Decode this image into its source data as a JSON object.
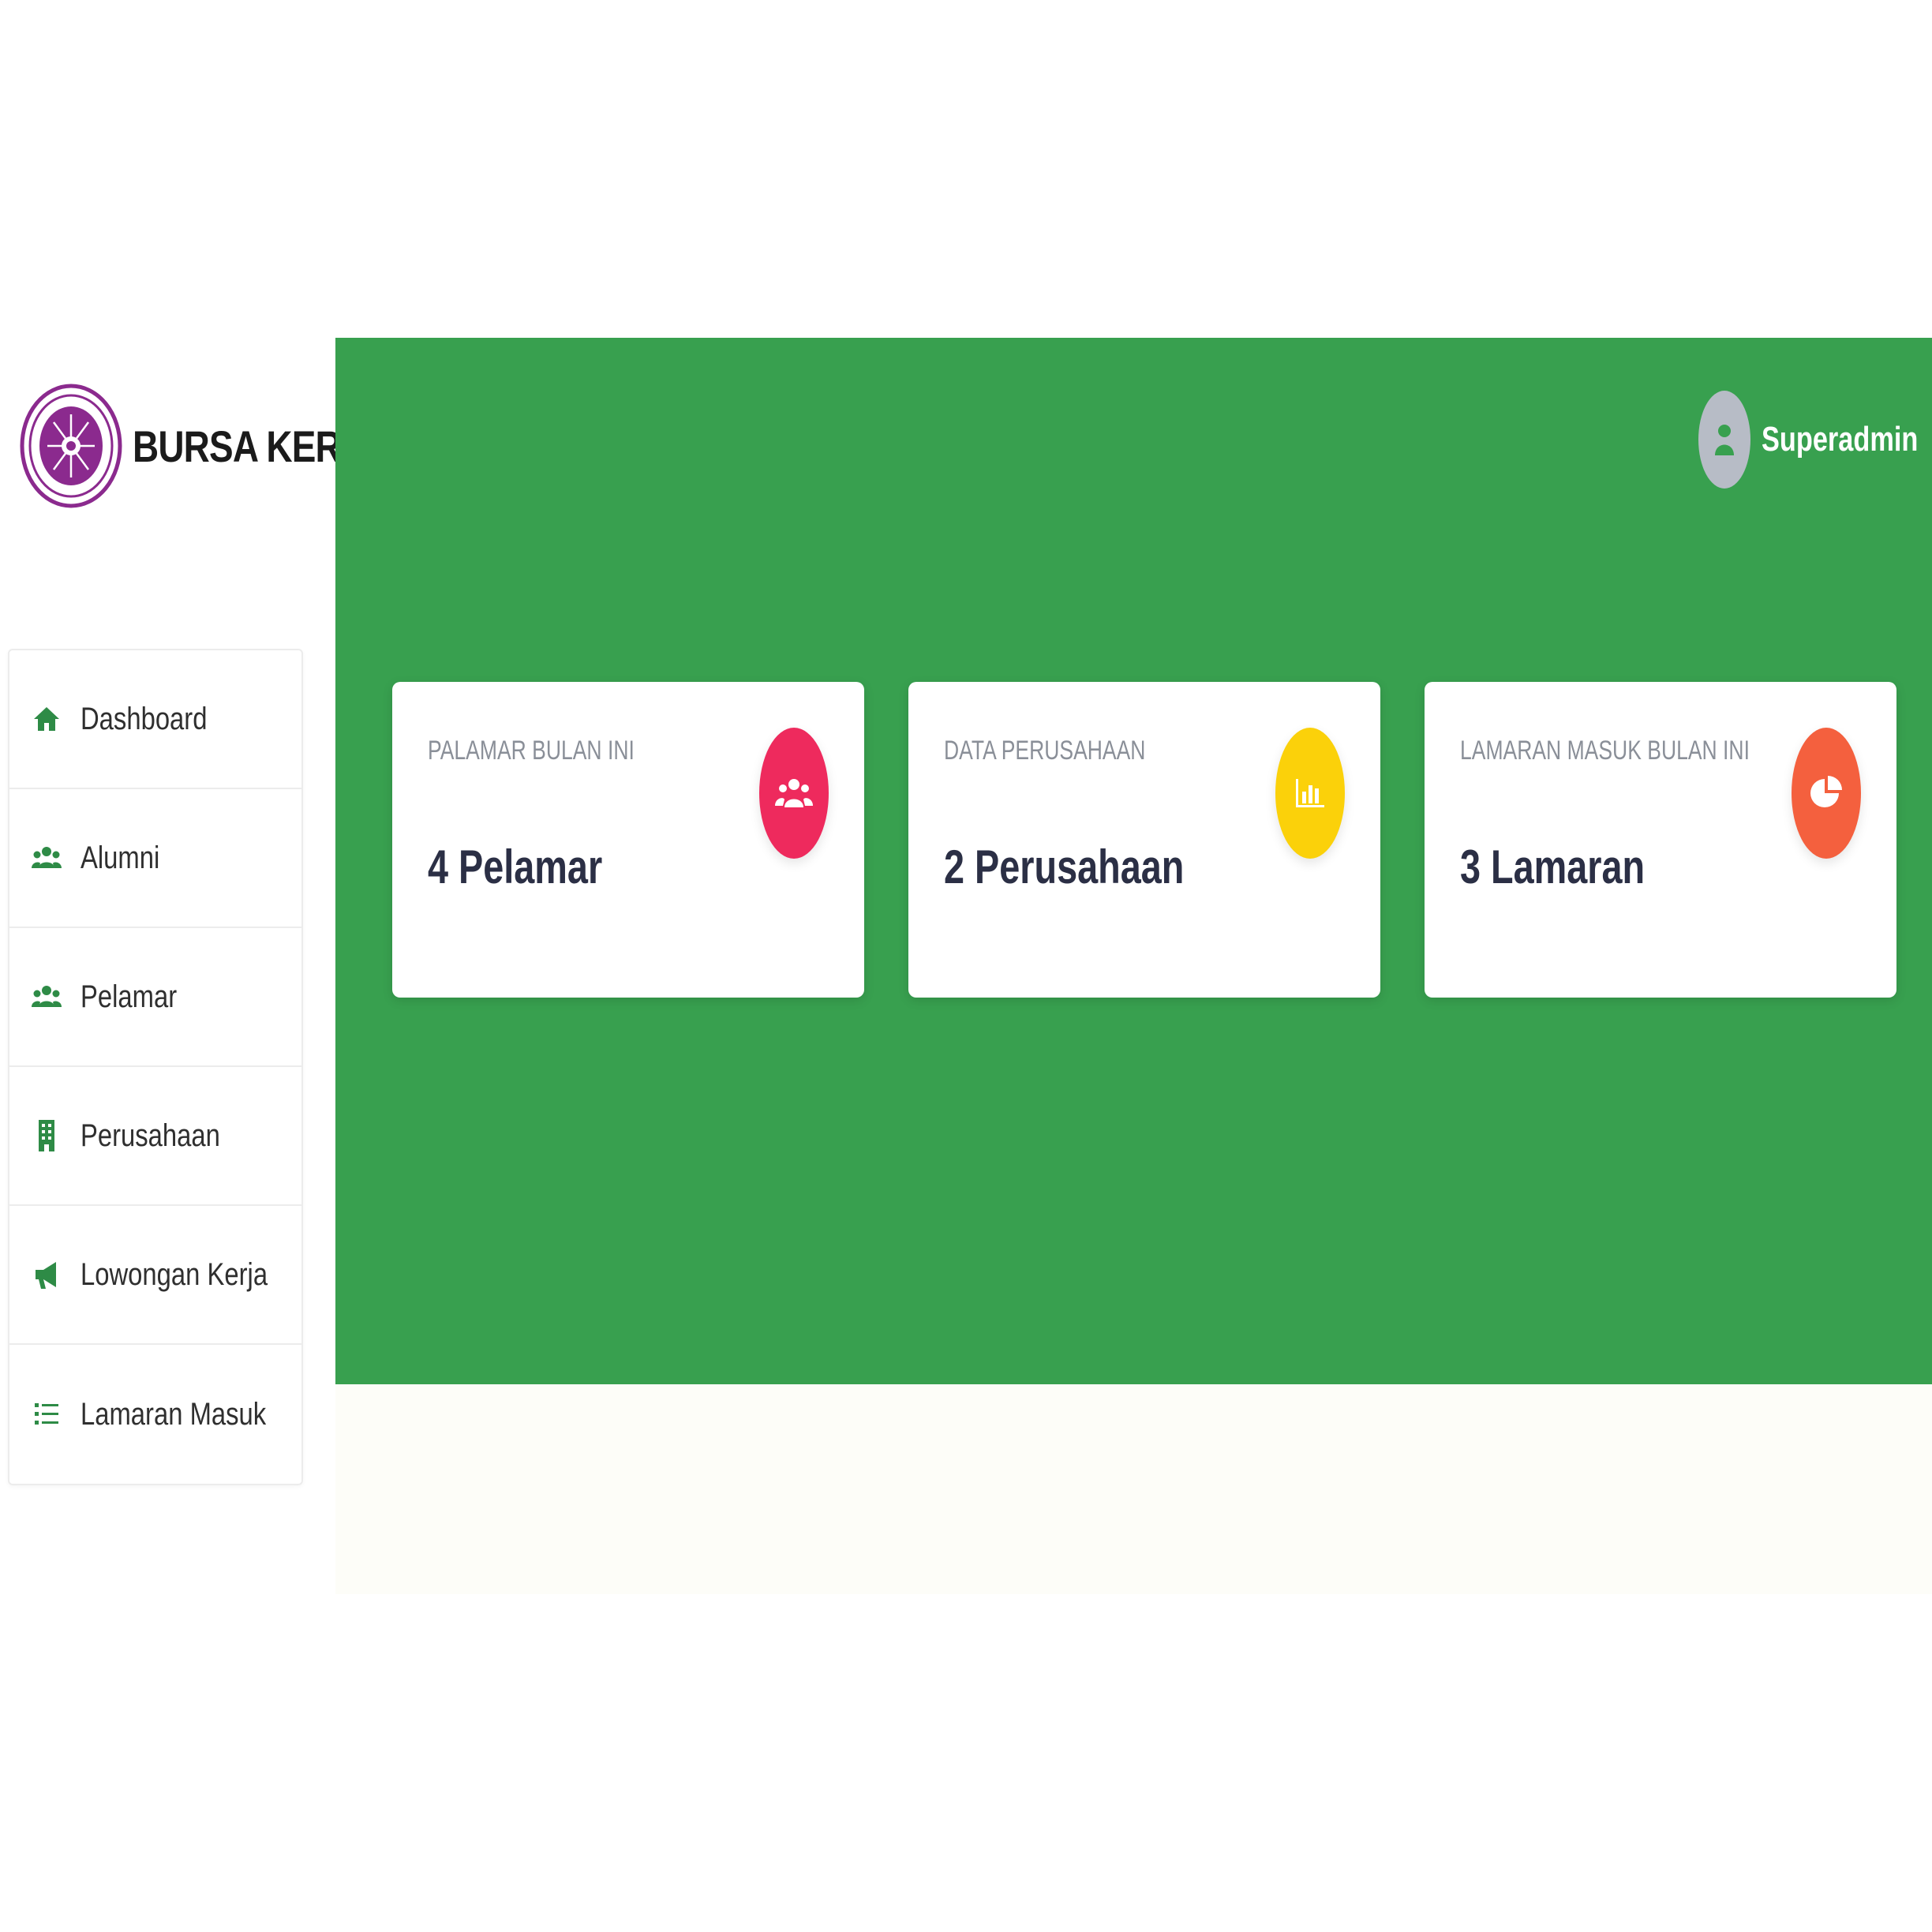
{
  "brand": {
    "name": "BURSA KERJA",
    "logo_icon": "university-seal-icon"
  },
  "sidebar": {
    "items": [
      {
        "label": "Dashboard",
        "icon": "home-icon"
      },
      {
        "label": "Alumni",
        "icon": "users-icon"
      },
      {
        "label": "Pelamar",
        "icon": "users-icon"
      },
      {
        "label": "Perusahaan",
        "icon": "building-icon"
      },
      {
        "label": "Lowongan Kerja",
        "icon": "megaphone-icon"
      },
      {
        "label": "Lamaran Masuk",
        "icon": "list-icon"
      }
    ]
  },
  "header": {
    "user_name": "Superadmin",
    "user_icon": "user-icon"
  },
  "cards": [
    {
      "title": "PALAMAR BULAN INI",
      "value": "4 Pelamar",
      "icon": "users-group-icon",
      "color": "#ee2a5d"
    },
    {
      "title": "DATA PERUSAHAAN",
      "value": "2 Perusahaan",
      "icon": "bar-chart-icon",
      "color": "#fbd10a"
    },
    {
      "title": "LAMARAN MASUK BULAN INI",
      "value": "3 Lamaran",
      "icon": "pie-chart-icon",
      "color": "#f4603e"
    }
  ],
  "colors": {
    "primary_green": "#38a04f",
    "icon_green": "#2e8b46",
    "logo_purple": "#8b2a8e"
  }
}
